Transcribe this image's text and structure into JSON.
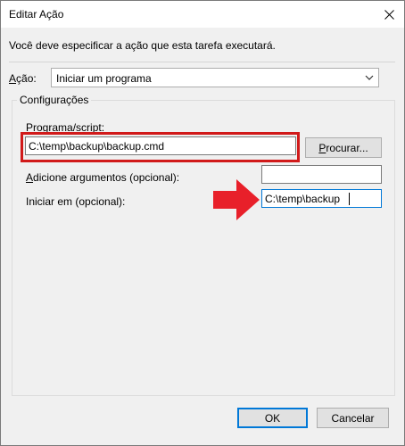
{
  "window": {
    "title": "Editar Ação",
    "close_icon": "close-icon"
  },
  "instruction": "Você deve especificar a ação que esta tarefa executará.",
  "action": {
    "label_prefix": "",
    "label_underlined": "A",
    "label_rest": "ção:",
    "selected": "Iniciar um programa"
  },
  "settings": {
    "group_label": "Configurações",
    "program_label_underlined": "P",
    "program_label_rest": "rograma/script:",
    "program_value": "C:\\temp\\backup\\backup.cmd",
    "browse_underlined": "P",
    "browse_rest": "rocurar...",
    "args_label_underlined": "A",
    "args_label_rest": "dicione argumentos (opcional):",
    "args_value": "",
    "startin_label": "Iniciar em (opcional):",
    "startin_value": "C:\\temp\\backup"
  },
  "buttons": {
    "ok": "OK",
    "cancel": "Cancelar"
  },
  "colors": {
    "highlight_red": "#d11a1a",
    "focus_blue": "#0078d7"
  }
}
